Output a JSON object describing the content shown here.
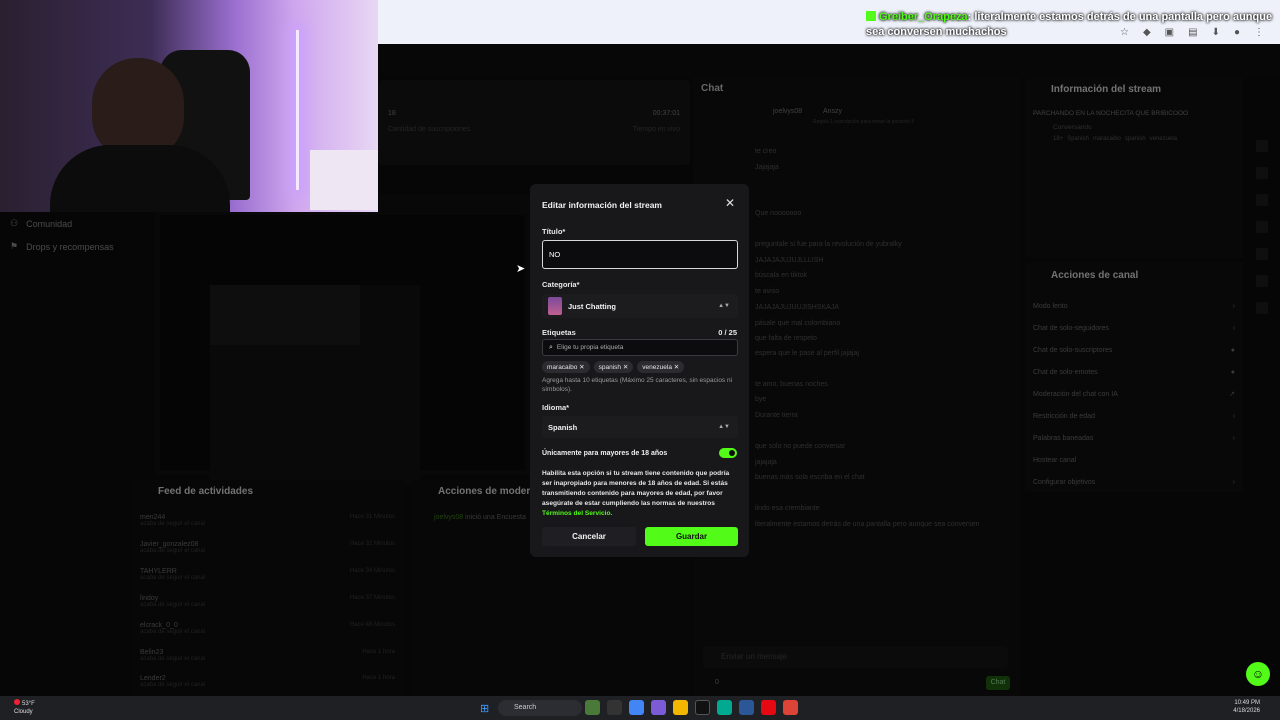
{
  "browser": {
    "overlay_user": "Greiber_Orapeza",
    "overlay_message": ": literalmente estamos detrás de una pantalla pero aunque sea conversen muchachos"
  },
  "stats": {
    "values": [
      "18",
      "00:37:01"
    ],
    "labels": [
      "Cantidad de suscripciones",
      "Tiempo en vivo"
    ]
  },
  "sidebar": {
    "items": [
      {
        "label": "Comunidad"
      },
      {
        "label": "Drops y recompensas"
      }
    ]
  },
  "chat": {
    "title": "Chat",
    "top_user": "joelvys08",
    "top_user2": "Anszy",
    "top_note": "Regala 1 suscripción para tomar la posición 5",
    "lines": [
      "te creo",
      "Jajajaja",
      "Que nooooooo",
      "preguntale si fue para la revolución de yubralky",
      "JAJAJAJUJUJLLLISH",
      "búscala en tiktok",
      "te aviso",
      "JAJAJAJUJUUJISHSKAJA",
      "pásale que mal colombiano",
      "que falta de respeto",
      "espera que le pase al perfil jajajaj",
      "te amo, buenas noches",
      "bye",
      "Durante tierra",
      "que solo no puede conversar",
      "jajajaja",
      "buenas más sola escriba en el chat",
      "lindo esa crembiante",
      "literalmente estamos detrás de una pantalla pero aunque sea conversen"
    ],
    "input_placeholder": "Enviar un mensaje",
    "count": "0",
    "send_label": "Chat"
  },
  "info": {
    "title": "Información del stream",
    "stream_title": "PARCHANDO EN LA NOCHECITA QUE BRIBICOOO",
    "category": "Conversando",
    "tags": [
      "18+",
      "Spanish",
      "maracaibo",
      "spanish",
      "venezuela"
    ]
  },
  "actions": {
    "title": "Acciones de canal",
    "rows": [
      {
        "label": "Modo lento"
      },
      {
        "label": "Chat de solo-seguidores"
      },
      {
        "label": "Chat de solo-suscriptores"
      },
      {
        "label": "Chat de solo-emotes"
      },
      {
        "label": "Moderación del chat con IA"
      },
      {
        "label": "Restricción de edad"
      },
      {
        "label": "Palabras baneadas"
      },
      {
        "label": "Hostear canal"
      },
      {
        "label": "Configurar objetivos"
      }
    ]
  },
  "activity": {
    "title": "Feed de actividades",
    "items": [
      {
        "user": "men244",
        "sub": "acaba de seguir el canal",
        "when": "Hace 31 Minutos"
      },
      {
        "user": "Javier_gonzalez08",
        "sub": "acaba de seguir el canal",
        "when": "Hace 32 Minutos"
      },
      {
        "user": "TAHYLERR",
        "sub": "acaba de seguir el canal",
        "when": "Hace 34 Minutos"
      },
      {
        "user": "lindoy",
        "sub": "acaba de seguir el canal",
        "when": "Hace 37 Minutos"
      },
      {
        "user": "elcrack_0_0",
        "sub": "acaba de seguir el canal",
        "when": "Hace 48 Minutos"
      },
      {
        "user": "Belin23",
        "sub": "acaba de seguir el canal",
        "when": "Hace 1 hora"
      },
      {
        "user": "Lender2",
        "sub": "acaba de seguir el canal",
        "when": "Hace 1 hora"
      }
    ]
  },
  "modactions": {
    "title": "Acciones de moderación",
    "entry_user": "joelvys08",
    "entry_text": "inició una Encuesta"
  },
  "modal": {
    "title": "Editar información del stream",
    "title_label": "Título*",
    "title_value": "NO",
    "category_label": "Categoría*",
    "category_value": "Just Chatting",
    "tags_label": "Etiquetas",
    "tags_count": "0 / 25",
    "tag_placeholder": "Elige tu propia etiqueta",
    "tags": [
      "maracaibo",
      "spanish",
      "venezuela"
    ],
    "tags_help": "Agrega hasta 10 etiquetas (Máximo 25 caracteres, sin espacios ni símbolos).",
    "language_label": "Idioma*",
    "language_value": "Spanish",
    "adult_label": "Únicamente para mayores de 18 años",
    "adult_enabled": true,
    "adult_help": "Habilita esta opción si tu stream tiene contenido que podría ser inapropiado para menores de 18 años de edad. Si estás transmitiendo contenido para mayores de edad, por favor asegúrate de estar cumpliendo las normas de nuestros",
    "adult_help_link": "Términos del Servicio.",
    "cancel_label": "Cancelar",
    "save_label": "Guardar"
  },
  "taskbar": {
    "temperature": "53°F",
    "weather": "Cloudy",
    "search_label": "Search",
    "time": "10:49 PM",
    "date": "4/18/2026"
  },
  "colors": {
    "accent": "#53fc18",
    "modal_bg": "#18181b",
    "page_bg": "#0b0b0c"
  }
}
